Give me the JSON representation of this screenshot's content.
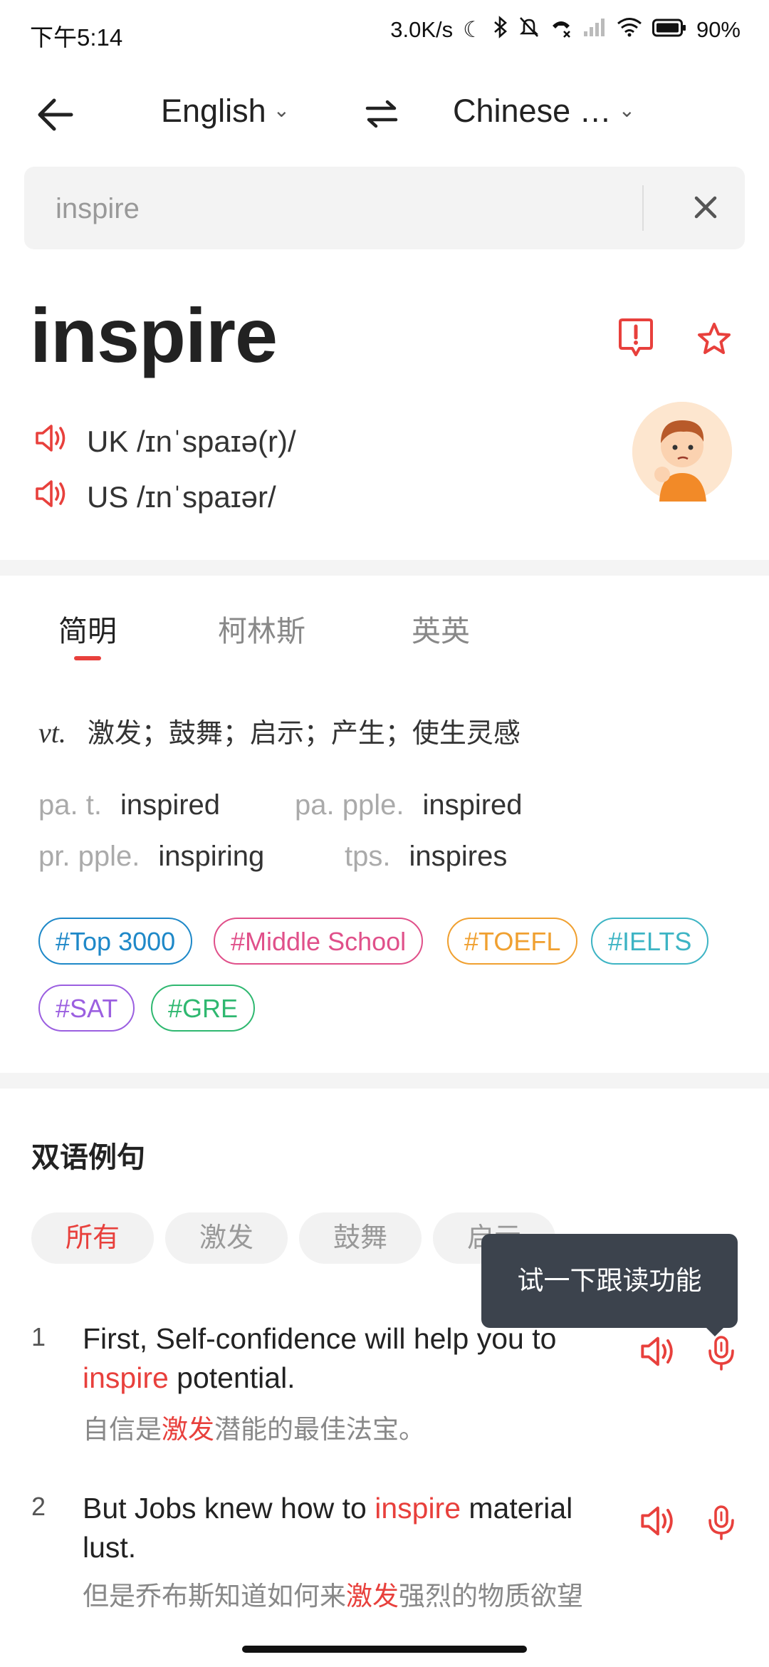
{
  "status_bar": {
    "time": "下午5:14",
    "net_speed": "3.0K/s",
    "battery": "90%"
  },
  "nav": {
    "source_lang": "English",
    "target_lang": "Chinese …"
  },
  "search": {
    "value": "inspire"
  },
  "word": {
    "headword": "inspire",
    "uk_label": "UK",
    "uk_ipa": "/ɪnˈspaɪə(r)/",
    "us_label": "US",
    "us_ipa": "/ɪnˈspaɪər/"
  },
  "tabs": [
    "简明",
    "柯林斯",
    "英英"
  ],
  "definition": {
    "pos": "vt.",
    "meaning": "激发；鼓舞；启示；产生；使生灵感"
  },
  "forms": [
    {
      "key": "pa. t.",
      "value": "inspired"
    },
    {
      "key": "pa. pple.",
      "value": "inspired"
    },
    {
      "key": "pr. pple.",
      "value": "inspiring"
    },
    {
      "key": "tps.",
      "value": "inspires"
    }
  ],
  "tags": [
    {
      "label": "#Top 3000",
      "color": "#1e88c8"
    },
    {
      "label": "#Middle School",
      "color": "#e0508a"
    },
    {
      "label": "#TOEFL",
      "color": "#f0a030"
    },
    {
      "label": "#IELTS",
      "color": "#3db4c4"
    },
    {
      "label": "#SAT",
      "color": "#9b5fe0"
    },
    {
      "label": "#GRE",
      "color": "#2fb870"
    }
  ],
  "examples_section": {
    "title": "双语例句",
    "chips": [
      "所有",
      "激发",
      "鼓舞",
      "启示"
    ],
    "tooltip": "试一下跟读功能"
  },
  "examples": [
    {
      "num": "1",
      "en_before": "First, Self-confidence will help you to ",
      "en_highlight": "inspire",
      "en_after": " potential.",
      "zh_before": "自信是",
      "zh_highlight": "激发",
      "zh_after": "潜能的最佳法宝。"
    },
    {
      "num": "2",
      "en_before": "But Jobs knew how to ",
      "en_highlight": "inspire",
      "en_after": " material lust.",
      "zh_before": "但是乔布斯知道如何来",
      "zh_highlight": "激发",
      "zh_after": "强烈的物质欲望"
    }
  ],
  "colors": {
    "accent": "#e8403c",
    "tooltip_bg": "#3c434d"
  }
}
